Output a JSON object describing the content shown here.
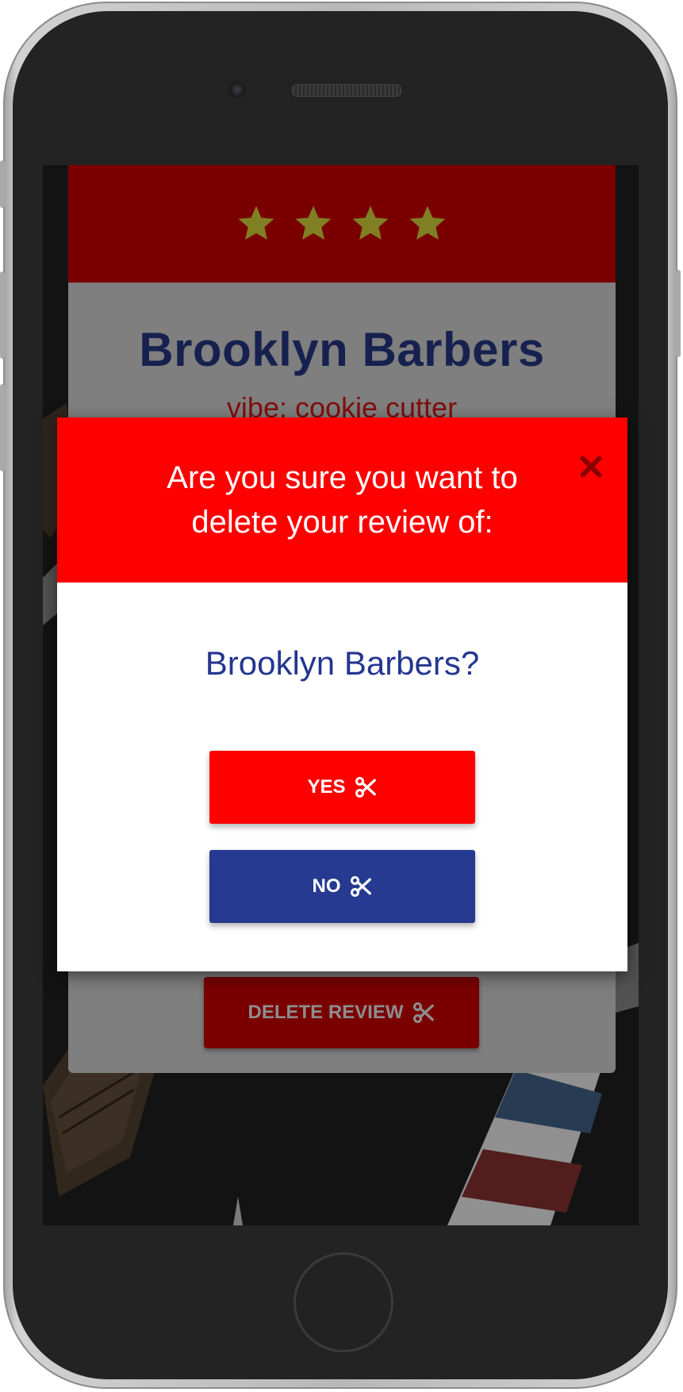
{
  "review": {
    "stars": 4,
    "shop_name": "Brooklyn Barbers",
    "vibe": "vibe: cookie cutter",
    "delete_label": "DELETE REVIEW"
  },
  "modal": {
    "title": "Are you sure you want to delete your review of:",
    "subject": "Brooklyn Barbers?",
    "yes_label": "YES",
    "no_label": "NO",
    "close_icon": "close-icon"
  },
  "colors": {
    "card_header": "#850000",
    "modal_header": "#ff0000",
    "title_navy": "#1a2456",
    "no_button": "#263a91",
    "star": "#8b8a28"
  }
}
